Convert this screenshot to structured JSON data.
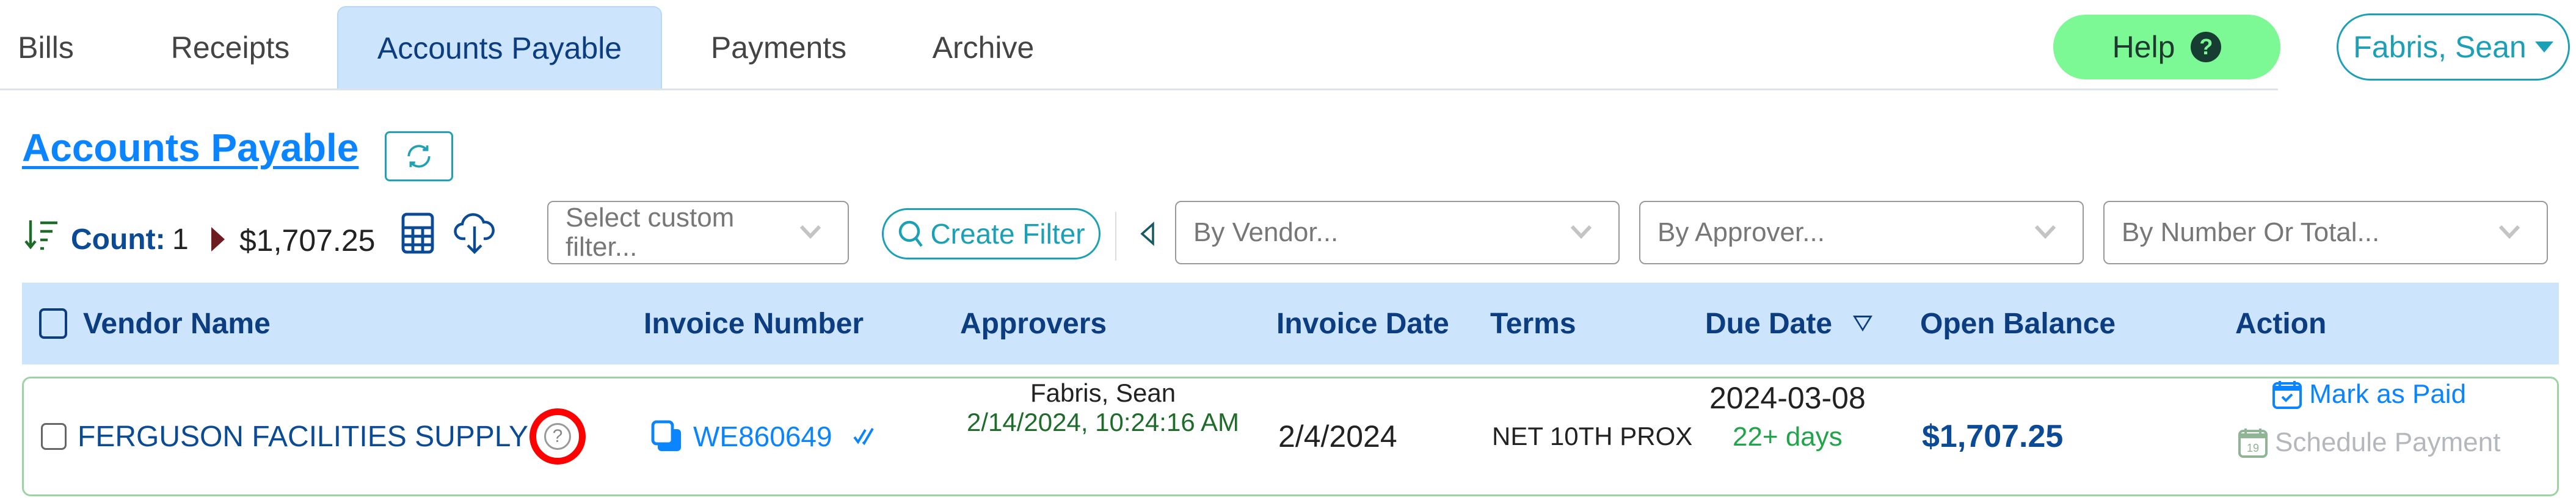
{
  "nav": {
    "tabs": [
      {
        "label": "Bills",
        "active": false
      },
      {
        "label": "Receipts",
        "active": false
      },
      {
        "label": "Accounts Payable",
        "active": true
      },
      {
        "label": "Payments",
        "active": false
      },
      {
        "label": "Archive",
        "active": false
      }
    ],
    "help_label": "Help",
    "help_icon": "?",
    "user_label": "Fabris, Sean"
  },
  "page": {
    "title": "Accounts Payable",
    "refresh_icon": "refresh-icon"
  },
  "toolbar": {
    "count_label": "Count:",
    "count_value": "1",
    "total_amount": "$1,707.25",
    "custom_filter_placeholder": "Select custom filter...",
    "create_filter_label": "Create Filter",
    "by_vendor_placeholder": "By Vendor...",
    "by_approver_placeholder": "By Approver...",
    "by_number_placeholder": "By Number Or Total..."
  },
  "table": {
    "columns": [
      "Vendor Name",
      "Invoice Number",
      "Approvers",
      "Invoice Date",
      "Terms",
      "Due Date",
      "Open Balance",
      "Action"
    ],
    "sorted_column": "Due Date",
    "rows": [
      {
        "vendor": "FERGUSON FACILITIES SUPPLY",
        "vendor_help": "?",
        "invoice_number": "WE860649",
        "approver_name": "Fabris, Sean",
        "approved_at": "2/14/2024, 10:24:16 AM",
        "invoice_date": "2/4/2024",
        "terms": "NET 10TH PROX",
        "due_date": "2024-03-08",
        "due_in": "22+ days",
        "open_balance": "$1,707.25",
        "actions": {
          "mark_paid": "Mark as Paid",
          "schedule_payment": "Schedule Payment",
          "schedule_icon_day": "19"
        }
      }
    ]
  },
  "colors": {
    "accent_blue": "#0a84ff",
    "navy": "#0b3d80",
    "teal": "#1ba0b6",
    "help_green": "#7cf994",
    "header_bg": "#cce5fc",
    "row_border": "#9fd2a2",
    "highlight_red": "#ff0000"
  }
}
